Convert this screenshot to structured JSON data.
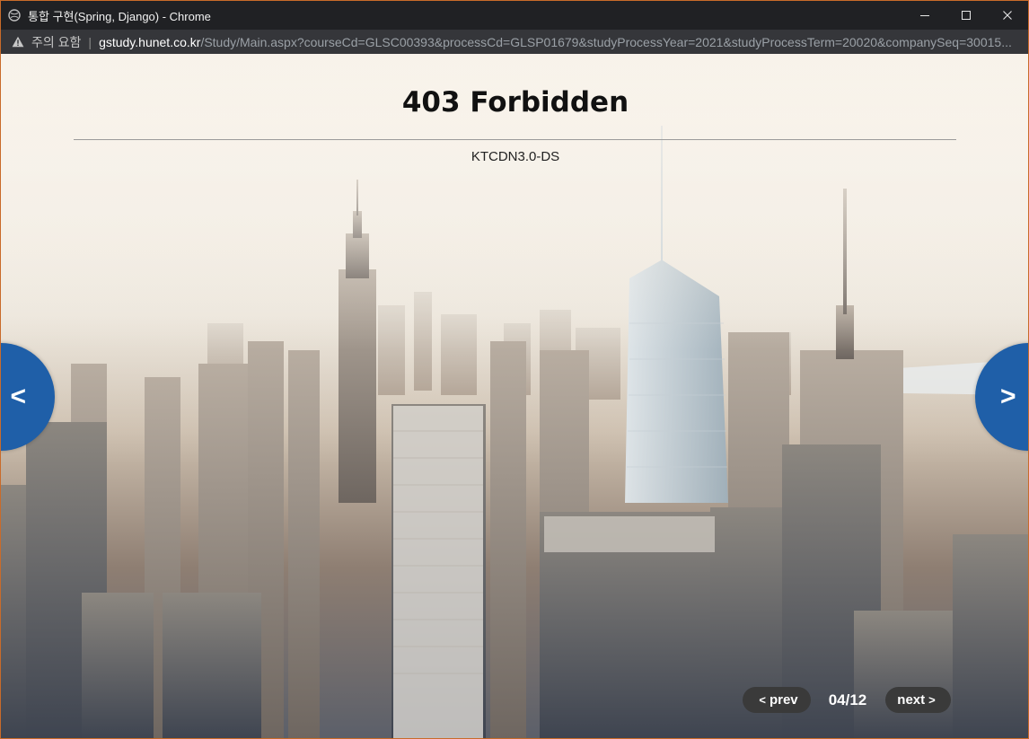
{
  "window": {
    "title": "통합 구현(Spring, Django) - Chrome"
  },
  "address": {
    "warning": "주의 요함",
    "separator": "|",
    "host": "gstudy.hunet.co.kr",
    "path": "/Study/Main.aspx?courseCd=GLSC00393&processCd=GLSP01679&studyProcessYear=2021&studyProcessTerm=20020&companySeq=30015..."
  },
  "page": {
    "heading": "403 Forbidden",
    "server": "KTCDN3.0-DS"
  },
  "nav": {
    "left": "<",
    "right": ">"
  },
  "pager": {
    "prev_label": "prev",
    "next_label": "next",
    "prev_chevron": "<",
    "next_chevron": ">",
    "count": "04/12"
  },
  "icons": {
    "title": "globe-icon",
    "minimize": "minimize-icon",
    "maximize": "maximize-icon",
    "close": "close-icon",
    "warning": "warning-icon"
  },
  "colors": {
    "nav_arrow": "#1f5fa8",
    "pill": "#3a3a3a",
    "window_border": "#c96b2a"
  }
}
